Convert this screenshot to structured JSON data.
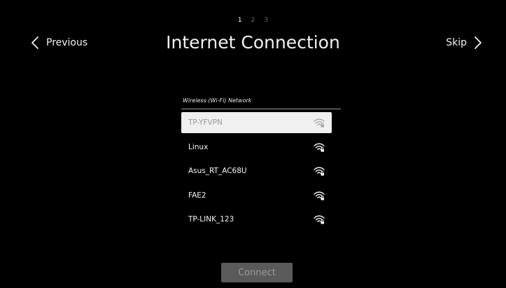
{
  "steps": [
    {
      "label": "1",
      "active": true
    },
    {
      "label": "2",
      "active": false
    },
    {
      "label": "3",
      "active": false
    }
  ],
  "header": {
    "title": "Internet Connection",
    "previous_label": "Previous",
    "skip_label": "Skip"
  },
  "network_list": {
    "header": "Wireless (Wi-Fi) Network",
    "selected_index": 0,
    "items": [
      {
        "name": "TP-YFVPN",
        "icon": "wifi-locked-icon"
      },
      {
        "name": "Linux",
        "icon": "wifi-locked-icon"
      },
      {
        "name": "Asus_RT_AC68U",
        "icon": "wifi-locked-icon"
      },
      {
        "name": "FAE2",
        "icon": "wifi-locked-icon"
      },
      {
        "name": "TP-LINK_123",
        "icon": "wifi-locked-icon"
      }
    ]
  },
  "connect_button": {
    "label": "Connect",
    "enabled": false
  },
  "colors": {
    "background": "#000000",
    "selected_row": "#f0f0f0",
    "connect_disabled_bg": "#5a5a5a",
    "muted_text": "#9a9a9a"
  }
}
